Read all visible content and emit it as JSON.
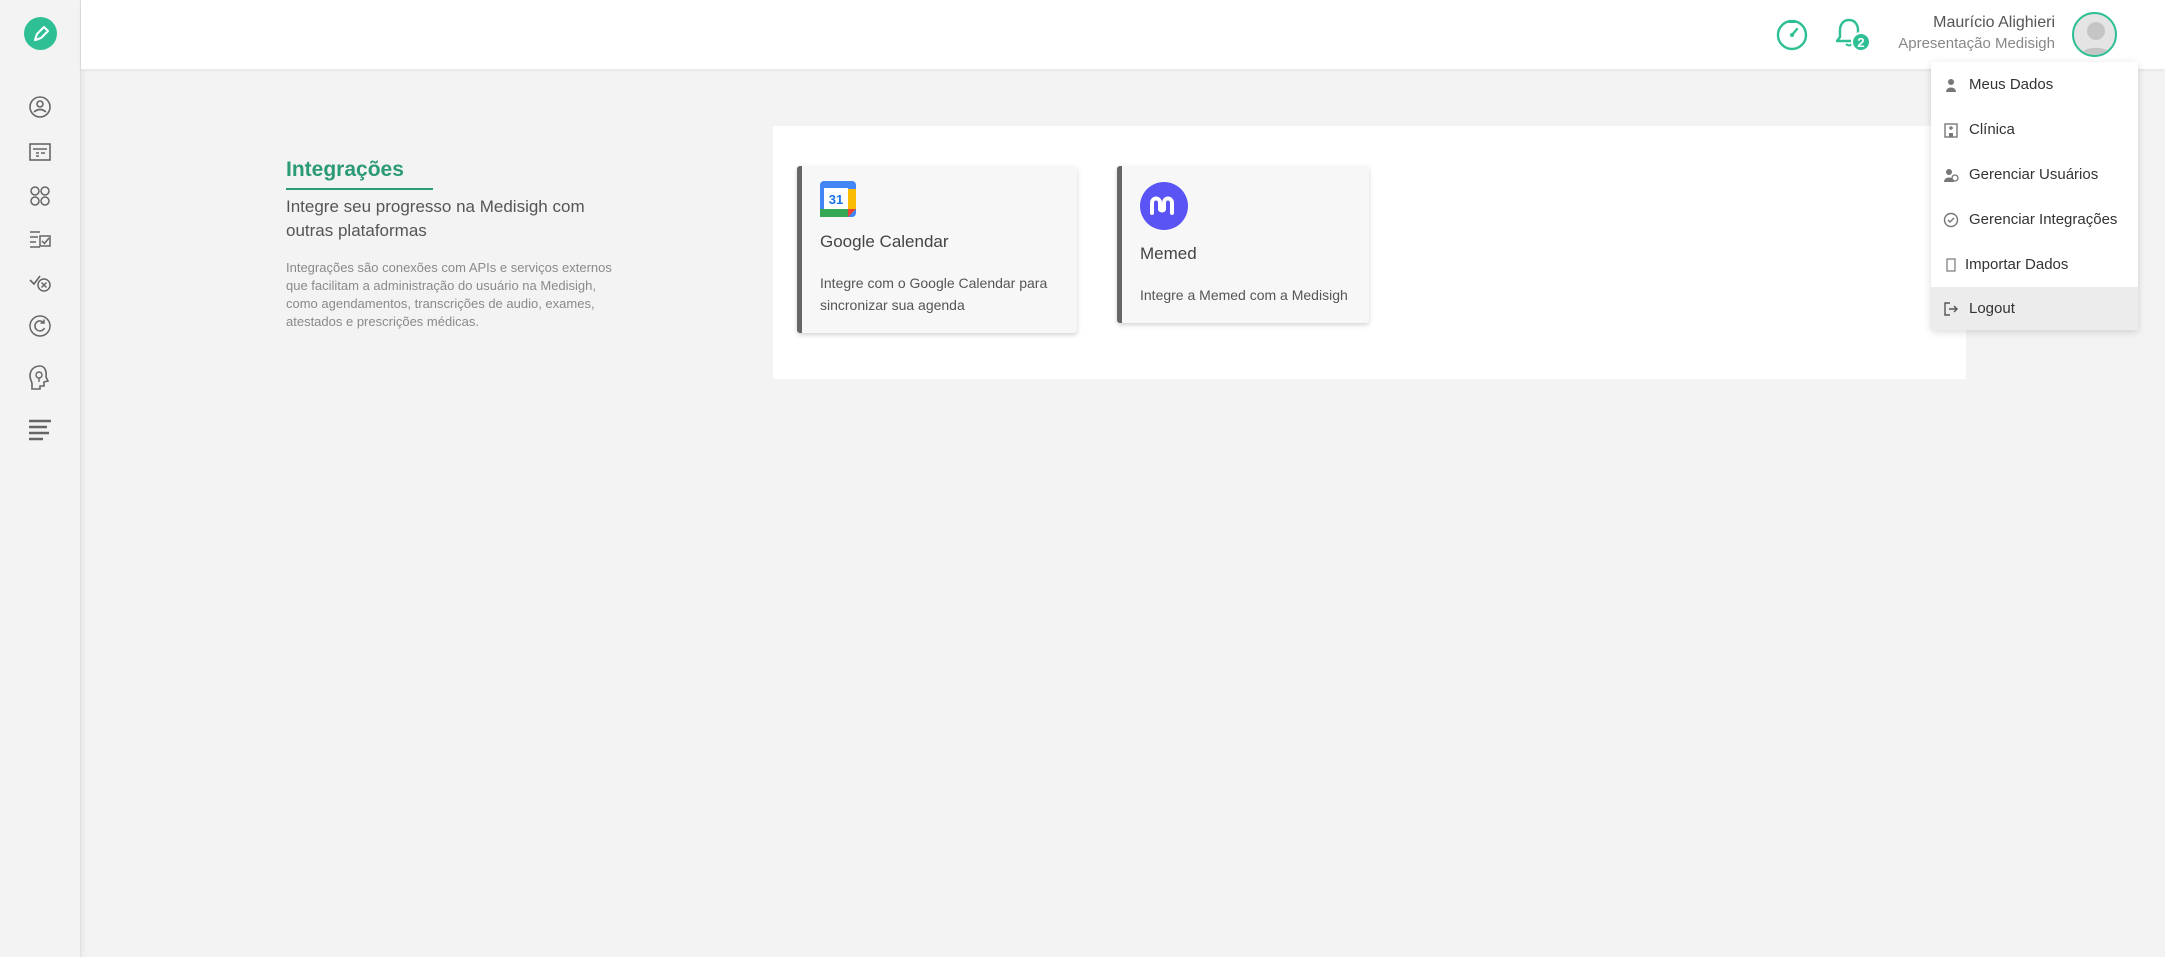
{
  "user": {
    "name": "Maurício Alighieri",
    "subtitle": "Apresentação Medisigh"
  },
  "notifications": {
    "count": "2"
  },
  "sidebar": {
    "items": [
      "home-icon",
      "calendar-icon",
      "connections-icon",
      "checklist-icon",
      "cancel-check-icon",
      "refresh-icon",
      "lightbulb-icon",
      "list-icon"
    ]
  },
  "intro": {
    "title": "Integrações",
    "subtitle": "Integre seu progresso na Medisigh com outras plataformas",
    "description": "Integrações são conexões com APIs e serviços externos que facilitam a administração do usuário na Medisigh, como agendamentos, transcrições de audio, exames, atestados e prescrições médicas."
  },
  "cards": [
    {
      "title": "Google Calendar",
      "description": "Integre com o Google Calendar para sincronizar sua agenda",
      "icon_day": "31"
    },
    {
      "title": "Memed",
      "description": "Integre a Memed com a Medisigh"
    }
  ],
  "menu": {
    "items": [
      {
        "label": "Meus Dados",
        "icon": "user-icon"
      },
      {
        "label": "Clínica",
        "icon": "clinic-icon"
      },
      {
        "label": "Gerenciar Usuários",
        "icon": "users-icon"
      },
      {
        "label": "Gerenciar Integrações",
        "icon": "integrations-icon"
      },
      {
        "label": "Importar Dados",
        "icon": "import-icon"
      },
      {
        "label": "Logout",
        "icon": "logout-icon"
      }
    ]
  },
  "colors": {
    "accent": "#2fbf95",
    "title": "#2b9a76",
    "memed": "#5b54f5"
  }
}
